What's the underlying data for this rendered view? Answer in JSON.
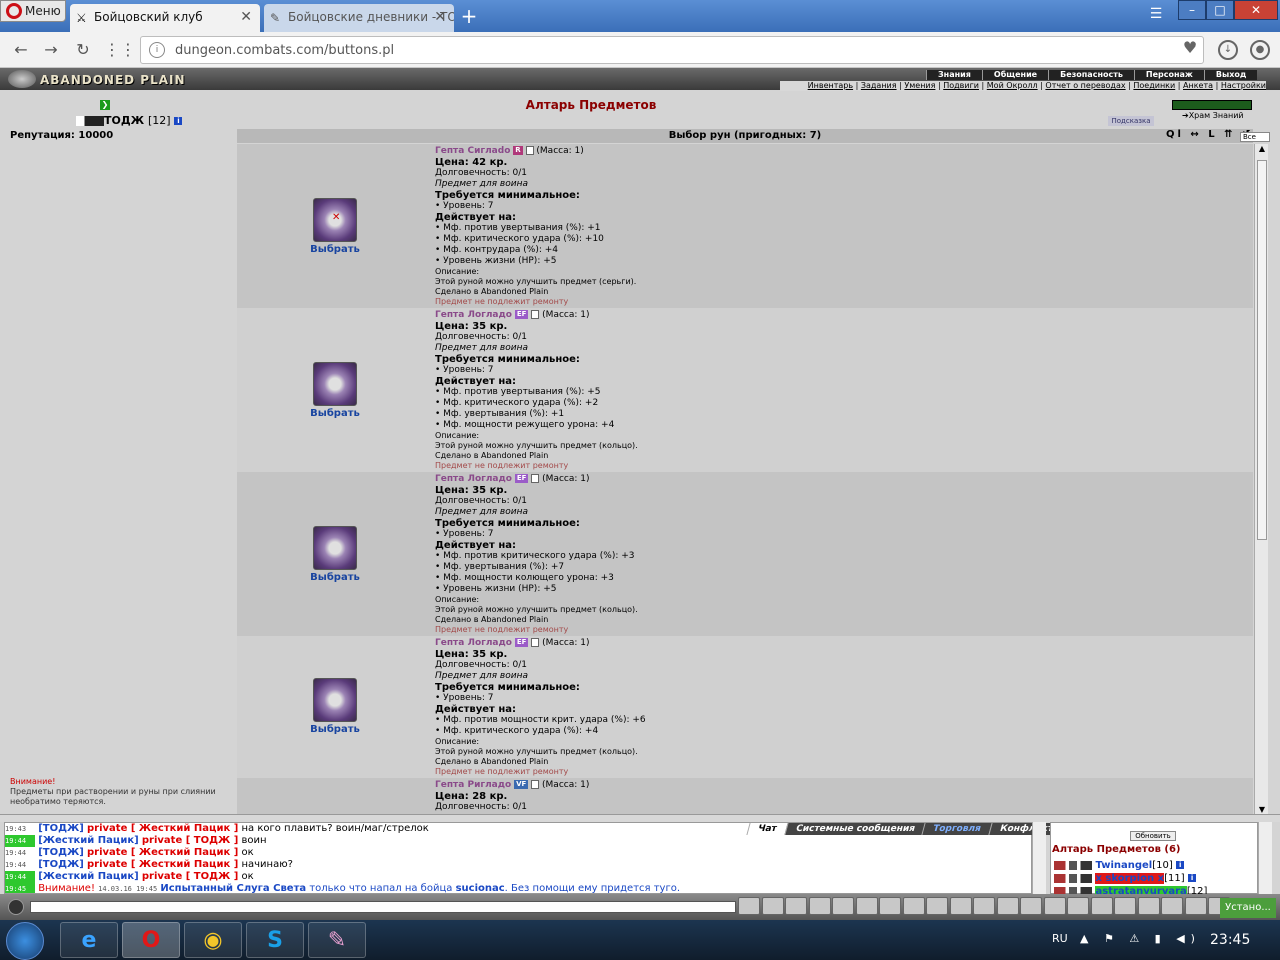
{
  "browser": {
    "menu_label": "Меню",
    "tabs": [
      {
        "title": "Бойцовский клуб",
        "active": true
      },
      {
        "title": "Бойцовские дневники - ТО",
        "active": false
      }
    ],
    "new_tab": "+",
    "url": "dungeon.combats.com/buttons.pl"
  },
  "game": {
    "logo_text": "ABANDONED PLAIN",
    "top_menu": [
      "Знания",
      "Общение",
      "Безопасность",
      "Персонаж",
      "Выход"
    ],
    "sub_menu": [
      "Инвентарь",
      "Задания",
      "Умения",
      "Подвиги",
      "Мой Окролл",
      "Отчет о переводах",
      "Поединки",
      "Анкета",
      "Настройки"
    ],
    "sub_sep": " | ",
    "level_box": "❯",
    "player": {
      "name": "ТОДЖ",
      "level": "[12]"
    },
    "reputation_label": "Репутация:",
    "reputation_value": "10000",
    "warning_title": "Внимание!",
    "warning_text": "Предметы при растворении и руны при слиянии необратимо теряются.",
    "page_title": "Алтарь Предметов",
    "temple_label": "Храм Знаний",
    "hint_button": "Подсказка",
    "list_header": "Выбор рун (пригодных: 7)",
    "header_icons": "Ql ↔ L ⇈ ↺",
    "all_button": "Все",
    "pick_label": "Выбрать",
    "labels": {
      "price": "Цена:",
      "durability": "Долговечность:",
      "for_whom": "Предмет для воина",
      "requires": "Требуется минимальное:",
      "acts_on": "Действует на:",
      "description": "Описание:",
      "made_in": "Сделано в Abandoned Plain",
      "no_repair": "Предмет не подлежит ремонту"
    },
    "items": [
      {
        "name": "Гепта Сиглado",
        "badge": "R",
        "badge_color": "#b0387a",
        "mass": "(Масса: 1)",
        "price": "42 кр.",
        "durability": "0/1",
        "req": "• Уровень: 7",
        "effects": [
          "• Мф. против увертывания (%): +1",
          "• Мф. критического удара (%): +10",
          "• Мф. контрудара (%): +4",
          "• Уровень жизни (HP): +5"
        ],
        "desc": "Этой руной можно улучшить предмет (серьги).",
        "red_mark": true
      },
      {
        "name": "Гепта Логладо",
        "badge": "EF",
        "badge_color": "#9b5cc8",
        "mass": "(Масса: 1)",
        "price": "35 кр.",
        "durability": "0/1",
        "req": "• Уровень: 7",
        "effects": [
          "• Мф. против увертывания (%): +5",
          "• Мф. критического удара (%): +2",
          "• Мф. увертывания (%): +1",
          "• Мф. мощности режущего урона: +4"
        ],
        "desc": "Этой руной можно улучшить предмет (кольцо).",
        "red_mark": false
      },
      {
        "name": "Гепта Логладо",
        "badge": "EF",
        "badge_color": "#9b5cc8",
        "mass": "(Масса: 1)",
        "price": "35 кр.",
        "durability": "0/1",
        "req": "• Уровень: 7",
        "effects": [
          "• Мф. против критического удара (%): +3",
          "• Мф. увертывания (%): +7",
          "• Мф. мощности колющего урона: +3",
          "• Уровень жизни (HP): +5"
        ],
        "desc": "Этой руной можно улучшить предмет (кольцо).",
        "red_mark": false
      },
      {
        "name": "Гепта Логладо",
        "badge": "EF",
        "badge_color": "#9b5cc8",
        "mass": "(Масса: 1)",
        "price": "35 кр.",
        "durability": "0/1",
        "req": "• Уровень: 7",
        "effects": [
          "• Мф. против мощности крит. удара (%): +6",
          "• Мф. критического удара (%): +4"
        ],
        "desc": "Этой руной можно улучшить предмет (кольцо).",
        "red_mark": false
      },
      {
        "name": "Гепта Ригладо",
        "badge": "VF",
        "badge_color": "#3a6ab0",
        "mass": "(Масса: 1)",
        "price": "28 кр.",
        "durability": "0/1"
      }
    ]
  },
  "chat": {
    "tabs": [
      "Чат",
      "Системные сообщения",
      "Торговля",
      "Конфликты"
    ],
    "lines": [
      {
        "time": "19:43",
        "from": "[ТОДЖ]",
        "priv": "private [ Жесткий Пацик ]",
        "text": "на кого плавить? воин/маг/стрелок"
      },
      {
        "time": "19:44",
        "from": "[Жесткий Пацик]",
        "priv": "private [ ТОДЖ ]",
        "text": "воин"
      },
      {
        "time": "19:44",
        "from": "[ТОДЖ]",
        "priv": "private [ Жесткий Пацик ]",
        "text": "ок"
      },
      {
        "time": "19:44",
        "from": "[ТОДЖ]",
        "priv": "private [ Жесткий Пацик ]",
        "text": "начинаю?"
      },
      {
        "time": "19:44",
        "from": "[Жесткий Пацик]",
        "priv": "private [ ТОДЖ ]",
        "text": "ок"
      }
    ],
    "system_line": {
      "time": "19:45",
      "warn": "Внимание!",
      "date": "14.03.16 19:45",
      "who": "Испытанный Слуга Света",
      "mid": "только что напал на бойца",
      "victim": "sucionac",
      "end": ". Без помощи ему придется туго."
    }
  },
  "online": {
    "refresh_label": "Обновить",
    "location": "Алтарь Предметов (6)",
    "users": [
      {
        "name": "Twinangel",
        "level": "[10]"
      },
      {
        "name": "x skorpion x",
        "level": "[11]"
      },
      {
        "name": "astratanyurvara",
        "level": "[12]"
      }
    ]
  },
  "bottom": {
    "setup_button": "Устано..."
  },
  "taskbar": {
    "lang": "RU",
    "tray": "▲ ⚑ ⚠ ▮ ◀)",
    "time": "23:45"
  }
}
